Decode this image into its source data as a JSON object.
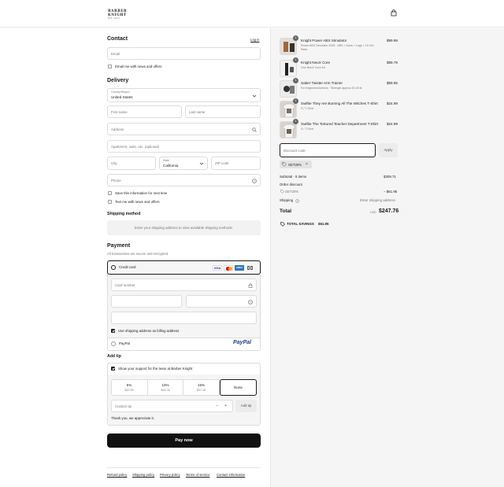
{
  "header": {
    "logo_line1": "BARBER",
    "logo_line2": "KNIGHT",
    "logo_sub": "EST. 2023"
  },
  "contact": {
    "title": "Contact",
    "login_label": "Log in",
    "email_placeholder": "Email",
    "news_label": "Email me with news and offers"
  },
  "delivery": {
    "title": "Delivery",
    "country_label": "Country/Region",
    "country_value": "United States",
    "first_name": "First name",
    "last_name": "Last name",
    "address": "Address",
    "apartment": "Apartment, suite, etc. (optional)",
    "city": "City",
    "state_label": "State",
    "state_value": "California",
    "zip": "ZIP code",
    "phone": "Phone",
    "save_info": "Save this information for next time",
    "text_me": "Text me with news and offers"
  },
  "shipping": {
    "title": "Shipping method",
    "message": "Enter your shipping address to view available shipping methods."
  },
  "payment": {
    "title": "Payment",
    "subtitle": "All transactions are secure and encrypted.",
    "credit_card": "Credit card",
    "card_number": "Card number",
    "billing_label": "Use shipping address as billing address",
    "paypal": "PayPal",
    "paypal_logo": "PayPal",
    "card_brands": {
      "visa": "VISA",
      "amex": "AMEX"
    }
  },
  "tip": {
    "title": "Add tip",
    "support_label": "Show your support for the team at Barber Knight",
    "options": [
      {
        "pct": "5%",
        "amt": "$12.39"
      },
      {
        "pct": "10%",
        "amt": "$24.78"
      },
      {
        "pct": "15%",
        "amt": "$37.16"
      },
      {
        "pct": "None",
        "amt": ""
      }
    ],
    "custom_placeholder": "Custom tip",
    "minus": "−",
    "plus": "+",
    "add_tip": "Add tip",
    "thanks": "Thank you, we appreciate it."
  },
  "pay_button": "Pay now",
  "footer": {
    "links": [
      "Refund policy",
      "Shipping policy",
      "Privacy policy",
      "Terms of service",
      "Contact information"
    ]
  },
  "order": {
    "items": [
      {
        "qty": "1",
        "name": "Knight Power ABS Simulator",
        "sub": "Power ABS Simulator 2025 · ABS + Arms + Legs + 10 Gel Pads",
        "price": "$99.99"
      },
      {
        "qty": "1",
        "name": "Knight NeuX Core",
        "sub": "One NeuX Core Kit",
        "price": "$99.79"
      },
      {
        "qty": "1",
        "name": "Saber Twister Arm Trainer",
        "sub": "For beginners/seniors · Strength approx 20-40 lb",
        "price": "$59.95"
      },
      {
        "qty": "1",
        "name": "Swiftie They Are Burning All The Witches T-Shirt",
        "sub": "S / T-Shirt",
        "price": "$24.99"
      },
      {
        "qty": "1",
        "name": "Swiftie The Tortured Teacher Department T-Shirt",
        "sub": "S / T-Shirt",
        "price": "$24.99"
      }
    ],
    "discount_placeholder": "Discount code",
    "apply": "Apply",
    "code_chip": "GET20%",
    "chip_close": "×",
    "subtotal_label": "Subtotal · 5 items",
    "subtotal": "$309.71",
    "order_discount_label": "Order discount",
    "discount_code": "GET20%",
    "discount_value": "− $61.95",
    "shipping_label": "Shipping",
    "shipping_value": "Enter shipping address",
    "total_label": "Total",
    "currency": "USD",
    "total": "$247.76",
    "savings_label": "TOTAL SAVINGS",
    "savings": "$61.95"
  }
}
